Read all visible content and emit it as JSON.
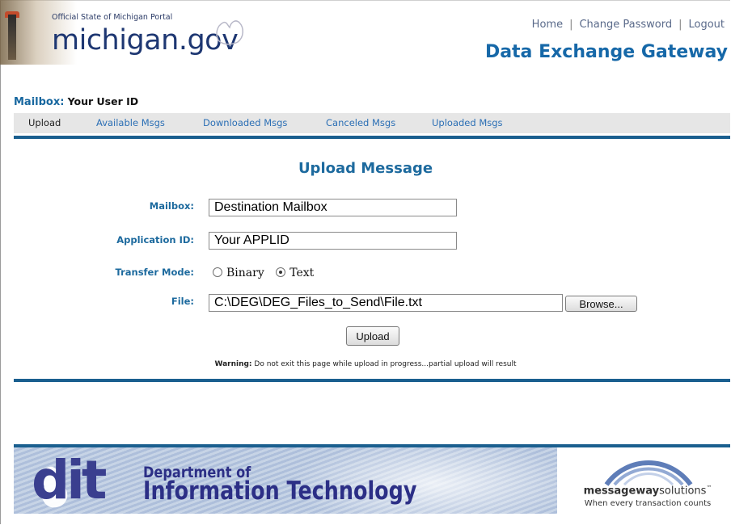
{
  "header": {
    "portal_small": "Official State of Michigan Portal",
    "portal_big": "michigan.gov",
    "links": [
      "Home",
      "Change Password",
      "Logout"
    ],
    "separator": "|",
    "app_title": "Data Exchange Gateway"
  },
  "mailbox_bar": {
    "label": "Mailbox:",
    "value": "Your User ID"
  },
  "tabs": [
    "Upload",
    "Available Msgs",
    "Downloaded Msgs",
    "Canceled Msgs",
    "Uploaded Msgs"
  ],
  "form": {
    "title": "Upload Message",
    "mailbox_label": "Mailbox:",
    "mailbox_value": "Destination Mailbox",
    "appid_label": "Application ID:",
    "appid_value": "Your APPLID",
    "mode_label": "Transfer Mode:",
    "mode_options": [
      "Binary",
      "Text"
    ],
    "mode_selected": "Text",
    "file_label": "File:",
    "file_value": "C:\\DEG\\DEG_Files_to_Send\\File.txt",
    "browse_label": "Browse...",
    "upload_label": "Upload",
    "warning_bold": "Warning:",
    "warning_text": " Do not exit this page while upload in progress...partial upload will result"
  },
  "footer": {
    "dit_letters": "dit",
    "dept_line1": "Department of",
    "dept_line2": "Information Technology",
    "mw_name_bold": "messageway",
    "mw_name_rest": "solutions",
    "mw_tm": "™",
    "mw_tagline": "When every transaction counts"
  },
  "colors": {
    "accent": "#1668a8",
    "bar": "#1a5f8f",
    "link": "#2b6fb5"
  }
}
